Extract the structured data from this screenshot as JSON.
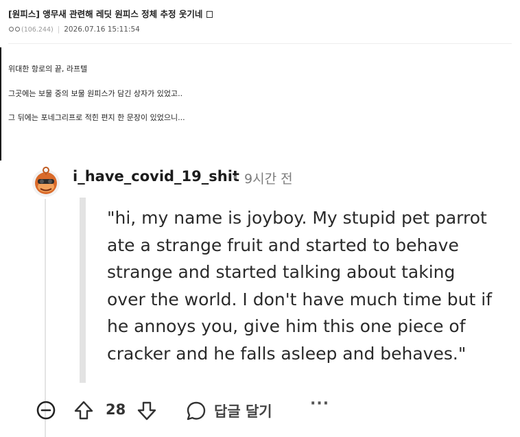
{
  "post": {
    "title": "[원피스] 앵무새 관련해 레딧 원피스 정체 추정 웃기네",
    "author_ip": "(106.244)",
    "separator": "|",
    "datetime": "2026.07.16 15:11:54"
  },
  "body_lines": [
    "위대한 항로의 끝, 라프텔",
    "그곳에는 보물 중의 보물 원피스가 담긴 상자가 있었고..",
    "그 뒤에는 포네그리프로 적힌 편지 한 문장이 있었으니..."
  ],
  "screenshot": {
    "username": "i_have_covid_19_shit",
    "dot": "•",
    "time": "9시간 전",
    "quote_lines": [
      "\"hi, my name is joyboy. My stupid pet parrot",
      "ate a strange fruit and started to behave",
      "strange and started talking about taking",
      "over the world. I don't have much time but if",
      "he annoys you, give him this one piece of",
      "cracker and he falls asleep and behaves.\""
    ],
    "vote_count": "28",
    "reply_label": "답글 달기",
    "more_label": "···"
  }
}
